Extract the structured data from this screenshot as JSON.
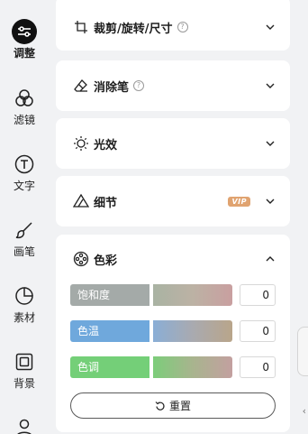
{
  "tools": [
    {
      "label": "调整",
      "icon": "adjust-sliders-icon",
      "active": true
    },
    {
      "label": "滤镜",
      "icon": "filter-circles-icon",
      "active": false
    },
    {
      "label": "文字",
      "icon": "text-t-icon",
      "active": false
    },
    {
      "label": "画笔",
      "icon": "brush-icon",
      "active": false
    },
    {
      "label": "素材",
      "icon": "sticker-icon",
      "active": false
    },
    {
      "label": "背景",
      "icon": "background-frame-icon",
      "active": false
    },
    {
      "label": "",
      "icon": "person-icon",
      "active": false
    }
  ],
  "sections": {
    "crop": {
      "title": "裁剪/旋转/尺寸",
      "help": "?",
      "icon": "crop-icon"
    },
    "eraser": {
      "title": "消除笔",
      "help": "?",
      "icon": "eraser-icon"
    },
    "light": {
      "title": "光效",
      "icon": "sun-icon"
    },
    "detail": {
      "title": "细节",
      "badge": "VIP",
      "icon": "triangle-icon"
    },
    "color": {
      "title": "色彩",
      "icon": "palette-icon",
      "expanded": true
    }
  },
  "color_sliders": [
    {
      "label": "饱和度",
      "value": "0",
      "label_color": "#a4aaa8",
      "track": "linear-gradient(90deg,#a9b3a3,#bcb2a4,#c99fa0)"
    },
    {
      "label": "色温",
      "value": "0",
      "label_color": "#6fa8dc",
      "track": "linear-gradient(90deg,#8aaed6,#a9aab0,#b9a58a)"
    },
    {
      "label": "色调",
      "value": "0",
      "label_color": "#74cf78",
      "track": "linear-gradient(90deg,#7ccd7a,#a8b48e,#c3a0a0)"
    }
  ],
  "reset_label": "重置",
  "collapse_glyph": "‹",
  "help_glyph": "?"
}
